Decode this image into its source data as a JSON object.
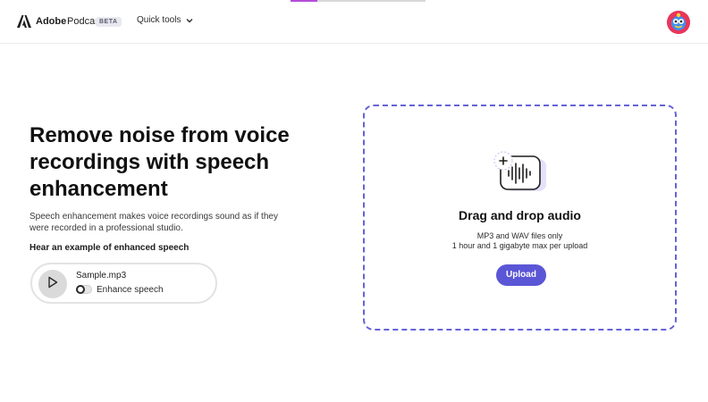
{
  "header": {
    "brand_adobe": "Adobe",
    "brand_product": "Podcast",
    "badge": "BETA",
    "menu_label": "Quick tools"
  },
  "hero": {
    "title": "Remove noise from voice recordings with speech enhancement",
    "description": "Speech enhancement makes voice recordings sound as if they were recorded in a professional studio.",
    "example_label": "Hear an example of enhanced speech"
  },
  "sample": {
    "file_name": "Sample.mp3",
    "toggle_label": "Enhance speech",
    "toggle_on": false
  },
  "dropzone": {
    "title": "Drag and drop audio",
    "formats": "MP3 and WAV files only",
    "limits": "1 hour and 1 gigabyte max per upload",
    "button_label": "Upload"
  },
  "icons": {
    "logo": "adobe-logo-icon",
    "menu_chevron": "chevron-down-icon",
    "play": "play-icon",
    "audio_upload": "audio-waveform-add-icon",
    "avatar": "user-avatar"
  },
  "colors": {
    "accent": "#5a56d6",
    "dropzone_border": "#6562d8",
    "avatar_bg": "#e9365a"
  }
}
